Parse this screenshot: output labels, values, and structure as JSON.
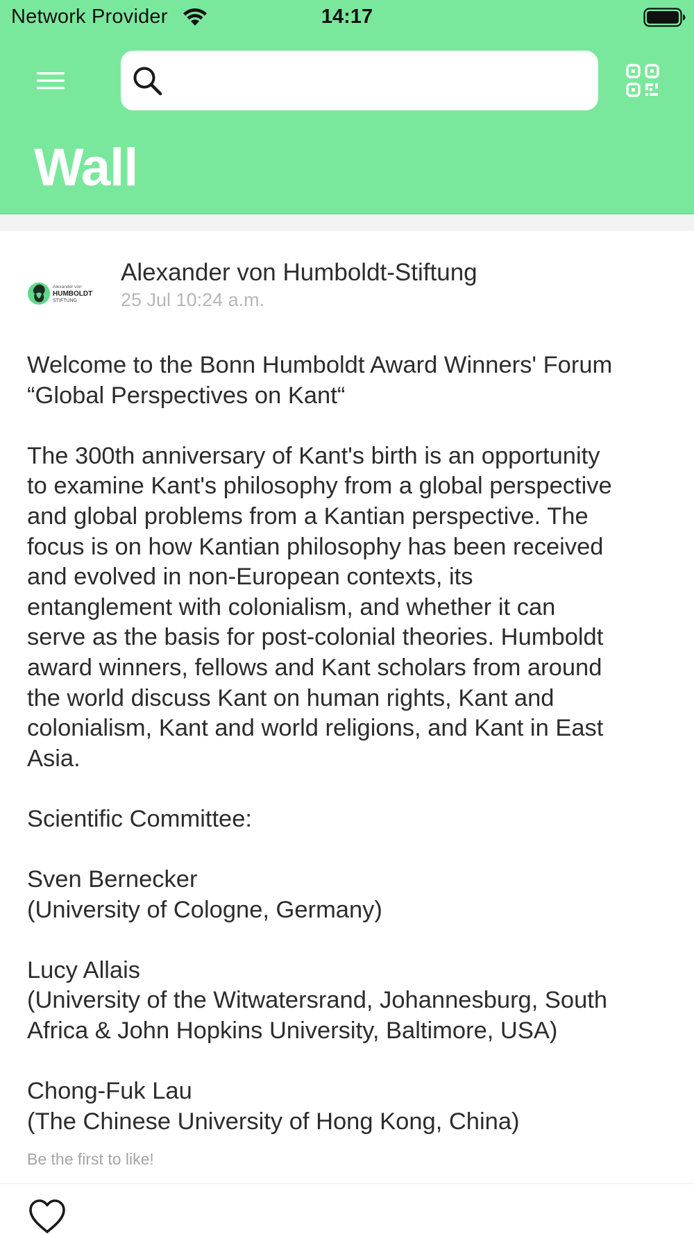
{
  "status_bar": {
    "carrier": "Network Provider",
    "time": "14:17"
  },
  "header": {
    "title": "Wall",
    "background_color": "#7ae89c",
    "search": {
      "placeholder": "",
      "value": ""
    },
    "icons": {
      "menu": "menu-icon",
      "search": "search-icon",
      "qr": "qr-code-icon"
    }
  },
  "post": {
    "author": "Alexander von Humboldt-Stiftung",
    "timestamp": "25 Jul 10:24 a.m.",
    "avatar_logo_text": {
      "small": "Alexander von",
      "main": "HUMBOLDT",
      "sub": "STIFTUNG"
    },
    "paragraphs": [
      [
        "Welcome to the Bonn Humboldt Award Winners' Forum",
        "“Global Perspectives on Kant“"
      ],
      [
        "The 300th anniversary of Kant's birth is an opportunity",
        "to examine Kant's philosophy from a global perspective",
        "and global problems from a Kantian perspective. The",
        "focus is on how Kantian philosophy has been received",
        "and evolved in non-European contexts, its",
        "entanglement with colonialism, and whether it can",
        "serve as the basis for post-colonial theories. Humboldt",
        "award winners, fellows and Kant scholars from around",
        "the world discuss Kant on human rights, Kant and",
        "colonialism, Kant and world religions, and Kant in East",
        "Asia."
      ],
      [
        "Scientific Committee:"
      ],
      [
        "Sven Bernecker",
        "(University of Cologne, Germany)"
      ],
      [
        "Lucy Allais",
        "(University of the Witwatersrand, Johannesburg, South",
        "Africa & John Hopkins University, Baltimore, USA)"
      ],
      [
        "Chong-Fuk Lau",
        "(The Chinese University of Hong Kong, China)"
      ]
    ],
    "likes_note": "Be the first to like!",
    "like_icon": "heart-icon"
  }
}
